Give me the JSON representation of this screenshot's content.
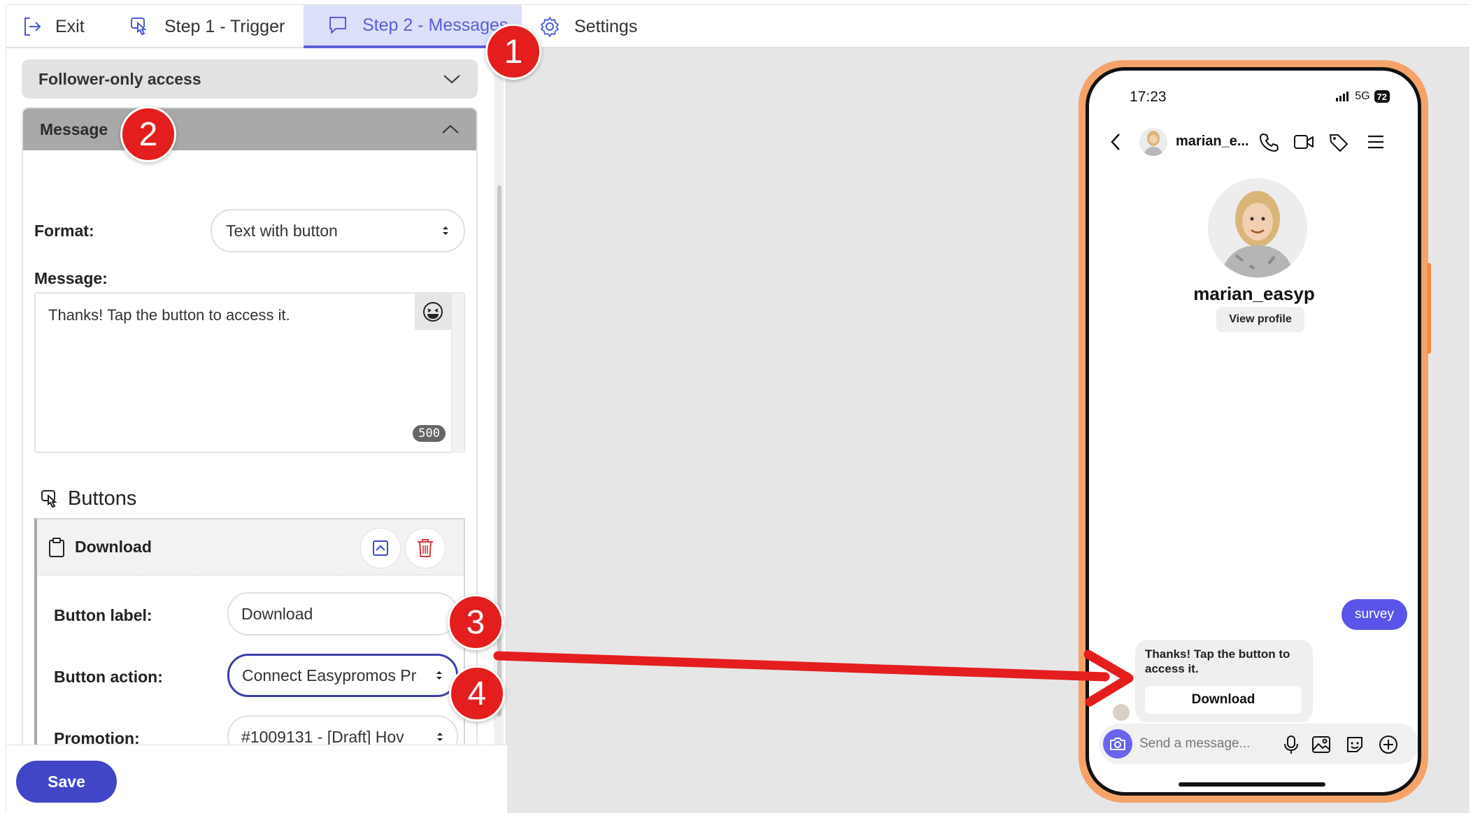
{
  "nav": {
    "exit_label": "Exit",
    "step1_label": "Step 1 - Trigger",
    "step2_label": "Step 2 - Messages",
    "settings_label": "Settings"
  },
  "accordion": {
    "follower_title": "Follower-only access",
    "message_title": "Message"
  },
  "form": {
    "format_label": "Format:",
    "format_value": "Text with button",
    "message_label": "Message:",
    "message_text": "Thanks! Tap the button to access it.",
    "char_count": "500"
  },
  "buttons_section": {
    "heading": "Buttons",
    "card_title": "Download",
    "button_label_label": "Button label:",
    "button_label_value": "Download",
    "button_action_label": "Button action:",
    "button_action_value": "Connect Easypromos Pr",
    "promotion_label": "Promotion:",
    "promotion_value": "#1009131 - [Draft] Hov"
  },
  "save_label": "Save",
  "phone": {
    "time": "17:23",
    "network": "5G",
    "battery": "72",
    "header_name": "marian_e...",
    "profile_name": "marian_easyp",
    "view_profile": "View profile",
    "sent_message": "survey",
    "reply_text": "Thanks! Tap the button to access it.",
    "reply_button": "Download",
    "composer_placeholder": "Send a message..."
  },
  "annotations": [
    "1",
    "2",
    "3",
    "4"
  ],
  "colors": {
    "accent": "#4146c7",
    "active_tab_bg": "#dcdff8",
    "annotation_red": "#e41e1e",
    "phone_frame": "#f4a36a",
    "sent_bubble": "#5a54e8"
  }
}
